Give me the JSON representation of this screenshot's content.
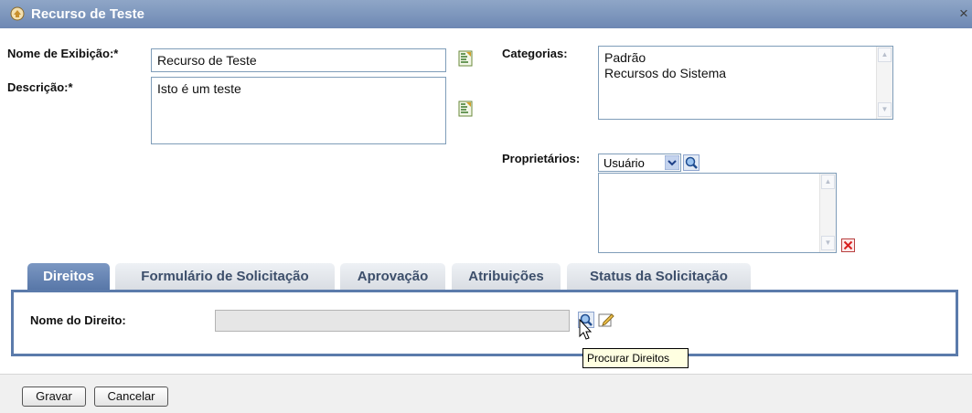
{
  "window": {
    "title": "Recurso de Teste",
    "close_glyph": "×",
    "icon": "resource-icon"
  },
  "form": {
    "display_name": {
      "label": "Nome de Exibição:*",
      "value": "Recurso de Teste"
    },
    "description": {
      "label": "Descrição:*",
      "value": "Isto é um teste"
    },
    "categories": {
      "label": "Categorias:",
      "items": [
        "Padrão",
        "Recursos do Sistema"
      ]
    },
    "owners": {
      "label": "Proprietários:",
      "type_selected": "Usuário",
      "items": []
    }
  },
  "tabs": [
    {
      "label": "Direitos",
      "active": true
    },
    {
      "label": "Formulário de Solicitação",
      "active": false
    },
    {
      "label": "Aprovação",
      "active": false
    },
    {
      "label": "Atribuições",
      "active": false
    },
    {
      "label": "Status da Solicitação",
      "active": false
    }
  ],
  "entitlements": {
    "label": "Nome do Direito:",
    "value": ""
  },
  "tooltip": "Procurar Direitos",
  "buttons": {
    "save": "Gravar",
    "cancel": "Cancelar"
  },
  "colors": {
    "title_bar": "#7590ba",
    "tab_active": "#6886b5",
    "panel_border": "#5b7bab",
    "tooltip_bg": "#ffffe1"
  }
}
